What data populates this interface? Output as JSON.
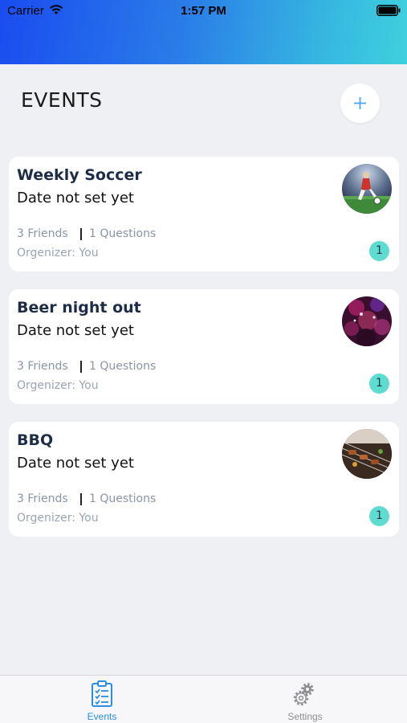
{
  "status_bar": {
    "carrier": "Carrier",
    "time": "1:57 PM"
  },
  "header": {
    "title": "EVENTS",
    "add_icon": "plus-icon"
  },
  "events": [
    {
      "title": "Weekly Soccer",
      "date": "Date not set yet",
      "friends": "3 Friends",
      "questions": "1 Questions",
      "organizer": "Orgenizer: You",
      "badge": "1",
      "thumbnail": "soccer-photo"
    },
    {
      "title": "Beer night out",
      "date": "Date not set yet",
      "friends": "3 Friends",
      "questions": "1 Questions",
      "organizer": "Orgenizer: You",
      "badge": "1",
      "thumbnail": "party-photo"
    },
    {
      "title": "BBQ",
      "date": "Date not set yet",
      "friends": "3 Friends",
      "questions": "1 Questions",
      "organizer": "Orgenizer: You",
      "badge": "1",
      "thumbnail": "bbq-photo"
    }
  ],
  "tab_bar": {
    "tabs": [
      {
        "label": "Events",
        "icon": "checklist-icon",
        "active": true
      },
      {
        "label": "Settings",
        "icon": "gear-icon",
        "active": false
      }
    ]
  },
  "colors": {
    "accent": "#2a8de8",
    "badge": "#5fdcd0",
    "title": "#1e2d47"
  }
}
